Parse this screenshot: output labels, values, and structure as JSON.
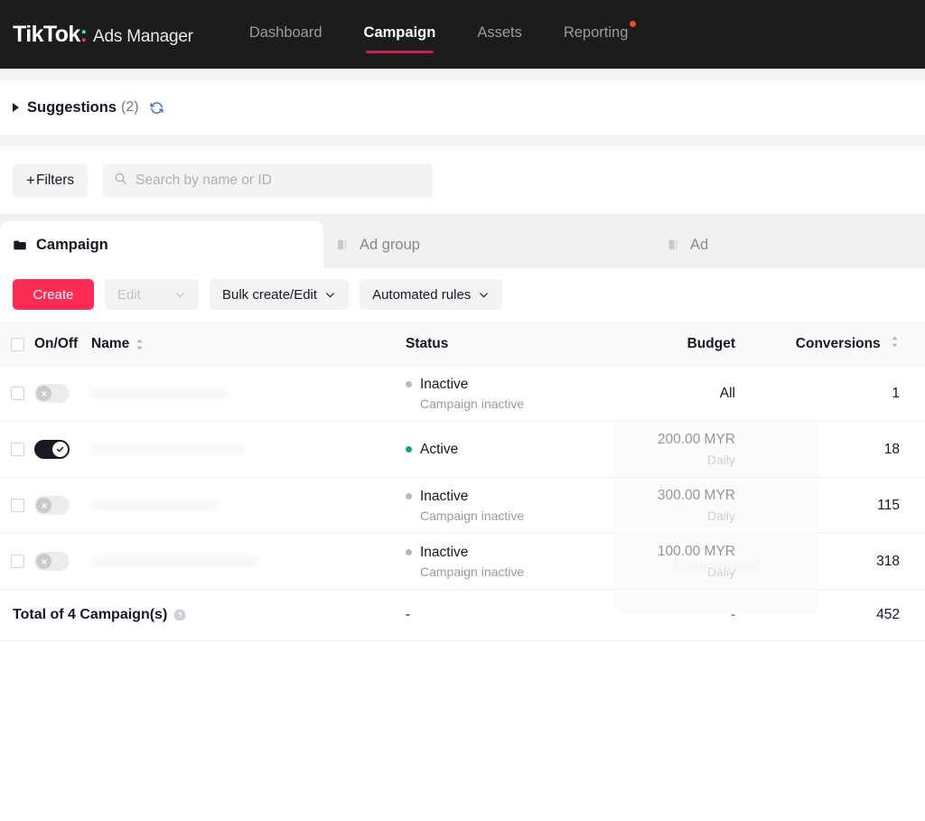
{
  "topnav": {
    "brand_primary": "TikTok",
    "brand_colon": ":",
    "brand_secondary": "Ads Manager",
    "items": [
      {
        "label": "Dashboard",
        "active": false,
        "dot": false
      },
      {
        "label": "Campaign",
        "active": true,
        "dot": false
      },
      {
        "label": "Assets",
        "active": false,
        "dot": false
      },
      {
        "label": "Reporting",
        "active": false,
        "dot": true
      }
    ]
  },
  "suggestions": {
    "label": "Suggestions",
    "count": "(2)",
    "refresh_icon": "refresh-icon",
    "expand_icon": "triangle-right-icon"
  },
  "filterbar": {
    "filters_plus": "+",
    "filters_label": "Filters",
    "search_placeholder": "Search by name or ID",
    "search_value": "",
    "search_icon": "search-icon"
  },
  "entity_tabs": [
    {
      "label": "Campaign",
      "icon": "folder-icon",
      "active": true
    },
    {
      "label": "Ad group",
      "icon": "adgroup-icon",
      "active": false
    },
    {
      "label": "Ad",
      "icon": "ad-icon",
      "active": false
    }
  ],
  "actions": {
    "create_label": "Create",
    "edit_label": "Edit",
    "bulk_label": "Bulk create/Edit",
    "automated_label": "Automated rules"
  },
  "table": {
    "headers": {
      "onoff": "On/Off",
      "name": "Name",
      "status": "Status",
      "budget": "Budget",
      "conversions": "Conversions"
    },
    "rows": [
      {
        "toggle": "off",
        "status": "Inactive",
        "status_color": "grey",
        "status_sub": "Campaign inactive",
        "budget": "All",
        "budget_sub": "",
        "conversions": "1"
      },
      {
        "toggle": "on",
        "status": "Active",
        "status_color": "green",
        "status_sub": "",
        "budget": "200.00 MYR",
        "budget_sub": "Daily",
        "conversions": "18"
      },
      {
        "toggle": "off",
        "status": "Inactive",
        "status_color": "grey",
        "status_sub": "Campaign inactive",
        "budget": "300.00 MYR",
        "budget_sub": "Daily",
        "conversions": "115"
      },
      {
        "toggle": "off",
        "status": "Inactive",
        "status_color": "grey",
        "status_sub": "Campaign inactive",
        "budget": "100.00 MYR",
        "budget_sub": "Daily",
        "conversions": "318"
      }
    ],
    "total": {
      "label": "Total of 4 Campaign(s)",
      "help_icon": "help-circle-icon",
      "status": "-",
      "budget": "-",
      "conversions": "452"
    }
  },
  "overlay": {
    "connected_text": "Connected"
  },
  "colors": {
    "accent_pink": "#fe2c55",
    "nav_bg": "#1c1c1c",
    "underline": "#c8214d",
    "status_active": "#0fab6e",
    "status_inactive": "#b7b7bd",
    "notification_dot": "#f54a1f"
  }
}
